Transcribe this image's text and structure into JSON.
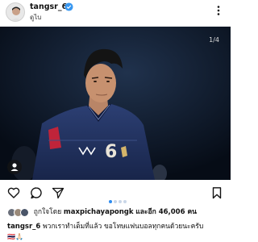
{
  "header": {
    "username": "tangsr_6",
    "location": "ดูไบ"
  },
  "photo": {
    "counter": "1/4",
    "jersey_number": "6"
  },
  "likes": {
    "prefix": "ถูกใจโดย",
    "liked_by": "maxpichayapongk",
    "suffix": "และอีก 46,006 คน"
  },
  "caption": {
    "username": "tangsr_6",
    "text": "พวกเราทำเต็มที่แล้ว ขอโทษแฟนบอลทุกคนด้วยนะครับ",
    "emoji": "🇹🇭🙏🏻"
  },
  "carousel": {
    "count": 4,
    "active": 1
  },
  "colors": {
    "verified": "#3897f0",
    "dot_active": "#2e8bef",
    "jersey": "#1f2f5c"
  }
}
